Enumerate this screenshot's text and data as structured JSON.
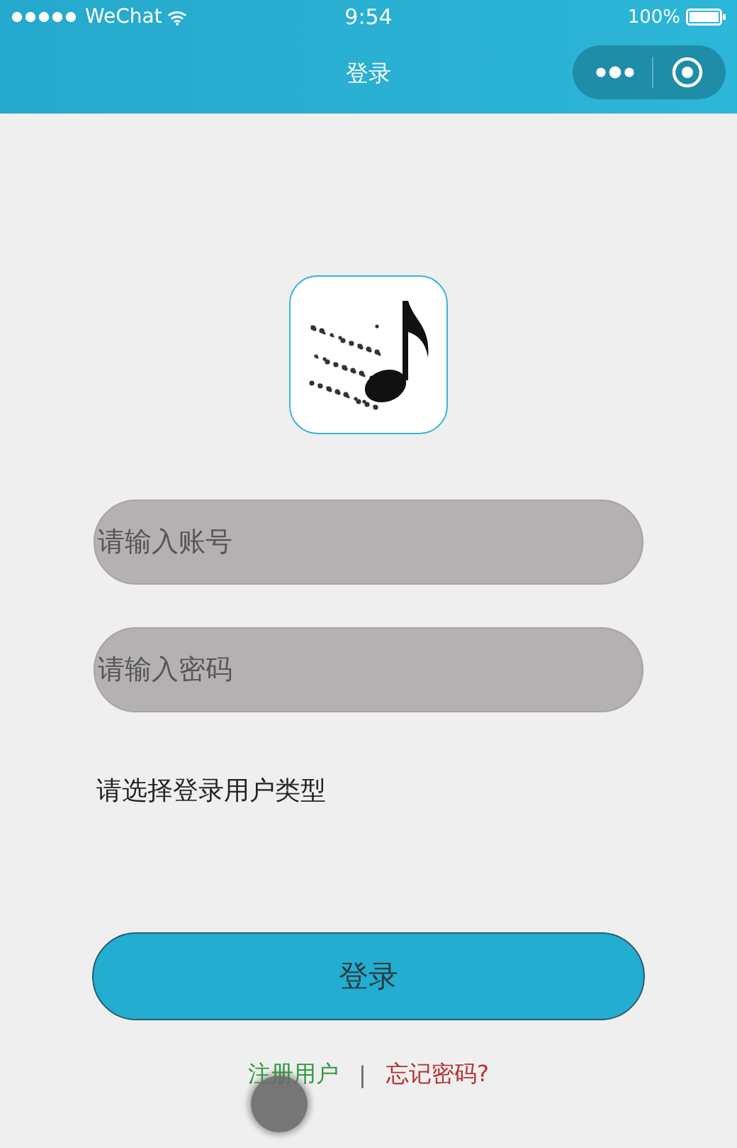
{
  "status_bar": {
    "carrier": "WeChat",
    "time": "9:54",
    "battery": "100%"
  },
  "nav_bar": {
    "title": "登录"
  },
  "form": {
    "account": {
      "placeholder": "请输入账号"
    },
    "password": {
      "placeholder": "请输入密码"
    },
    "user_type_label": "请选择登录用户类型",
    "login_button": "登录"
  },
  "links": {
    "register": "注册用户",
    "separator": "|",
    "forgot": "忘记密码?"
  }
}
